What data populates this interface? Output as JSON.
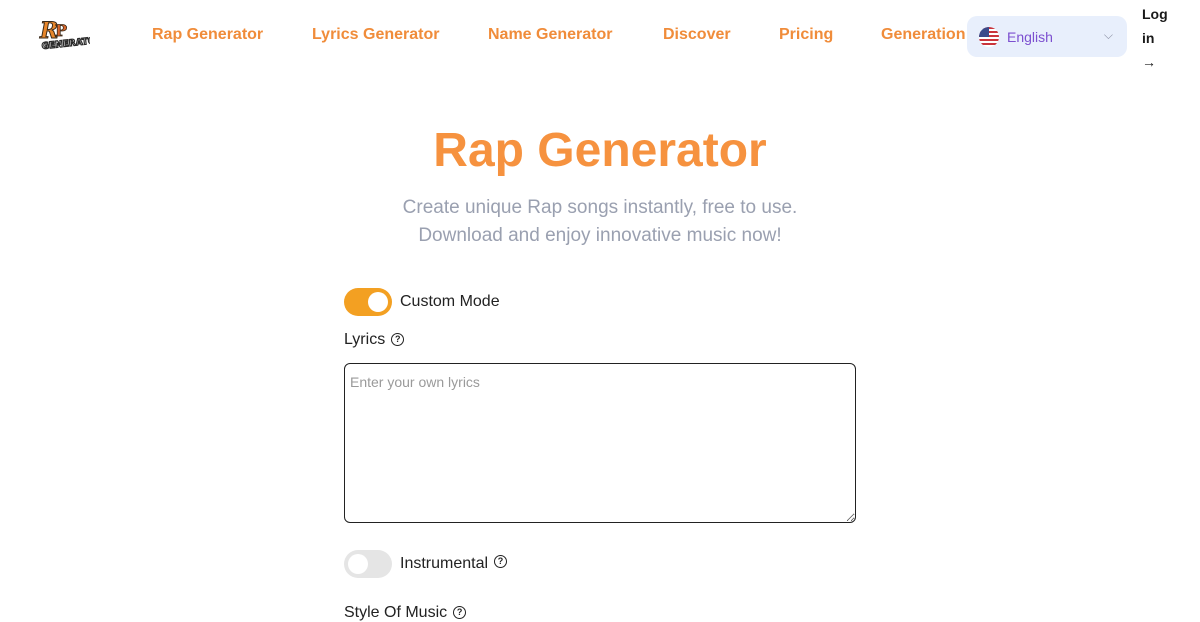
{
  "header": {
    "logo_alt": "Rap Generator",
    "nav": [
      {
        "label": "Rap Generator"
      },
      {
        "label": "Lyrics Generator"
      },
      {
        "label": "Name Generator"
      },
      {
        "label": "Discover"
      },
      {
        "label": "Pricing"
      },
      {
        "label": "Generation"
      }
    ],
    "language": {
      "selected": "English",
      "flag": "us-flag-icon"
    },
    "login_label": "Log in",
    "login_arrow": "→"
  },
  "hero": {
    "title": "Rap Generator",
    "subtitle_line1": "Create unique Rap songs instantly, free to use.",
    "subtitle_line2": "Download and enjoy innovative music now!"
  },
  "form": {
    "custom_mode": {
      "label": "Custom Mode",
      "enabled": true
    },
    "lyrics": {
      "label": "Lyrics",
      "placeholder": "Enter your own lyrics",
      "value": ""
    },
    "instrumental": {
      "label": "Instrumental",
      "enabled": false
    },
    "style_label": "Style Of Music"
  },
  "colors": {
    "accent": "#f6923f",
    "toggle_on": "#f3a022",
    "lang_bg": "#e8effc",
    "lang_text": "#7c4fd0"
  }
}
